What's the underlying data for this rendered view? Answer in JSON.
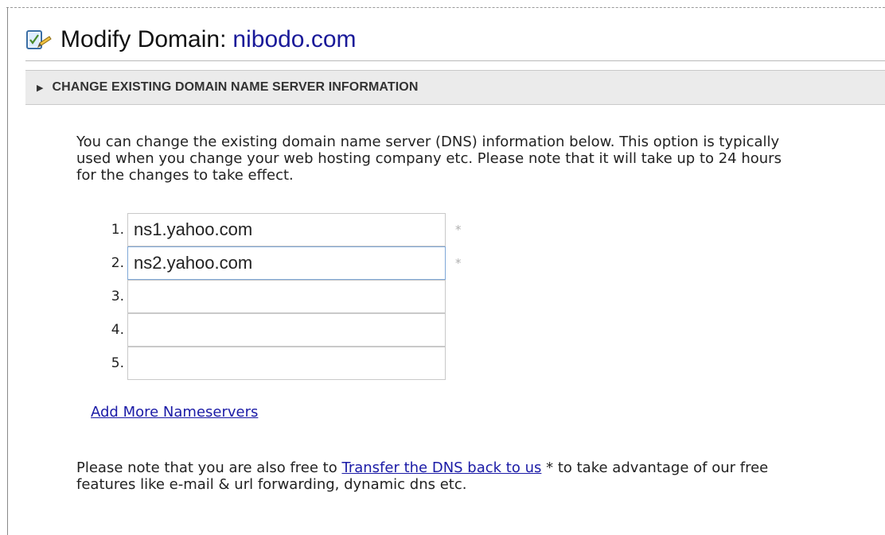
{
  "header": {
    "title_prefix": "Modify Domain:",
    "domain_name": "nibodo.com",
    "icon": "edit-form-icon"
  },
  "section": {
    "title": "CHANGE EXISTING DOMAIN NAME SERVER INFORMATION",
    "icon": "triangle-right-icon"
  },
  "intro_text": "You can change the existing domain name server (DNS) information below. This option is typically used when you change your web hosting company etc. Please note that it will take up to 24 hours for the changes to take effect.",
  "nameservers": [
    {
      "number": "1.",
      "value": "ns1.yahoo.com",
      "required_mark": "*"
    },
    {
      "number": "2.",
      "value": "ns2.yahoo.com",
      "required_mark": "*"
    },
    {
      "number": "3.",
      "value": "",
      "required_mark": ""
    },
    {
      "number": "4.",
      "value": "",
      "required_mark": ""
    },
    {
      "number": "5.",
      "value": "",
      "required_mark": ""
    }
  ],
  "add_more_link": "Add More Nameservers",
  "footer": {
    "text_before": "Please note that you are also free to ",
    "link_text": "Transfer the DNS back to us",
    "text_after": " * to take advantage of our free features like e-mail & url forwarding, dynamic dns etc."
  },
  "colors": {
    "link": "#1a1aa6",
    "domain": "#1a1a99",
    "section_bar": "#ebebeb",
    "input_focus_border": "#7fa8d7"
  }
}
